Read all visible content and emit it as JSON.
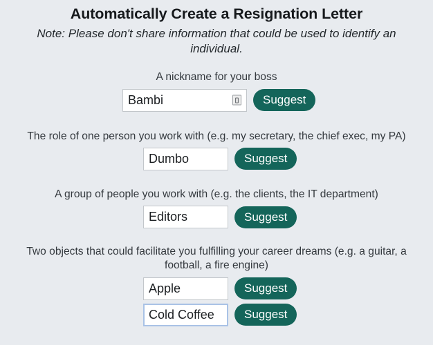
{
  "header": {
    "title": "Automatically Create a Resignation Letter",
    "note": "Note: Please don't share information that could be used to identify an individual."
  },
  "theme": {
    "background": "#e8ebef",
    "button_color": "#14655a",
    "button_text_color": "#ffffff",
    "input_background": "#ffffff",
    "input_border": "#c2c6ca",
    "focus_border": "#a9c2e6",
    "title_color": "#16191c",
    "label_color": "#34393e"
  },
  "fields": [
    {
      "label": "A nickname for your boss",
      "value": "Bambi",
      "placeholder": "",
      "button_label": "Suggest",
      "has_autofill_icon": true,
      "focused": false,
      "width": "wide"
    },
    {
      "label": "The role of one person you work with (e.g. my secretary, the chief exec, my PA)",
      "value": "Dumbo",
      "placeholder": "",
      "button_label": "Suggest",
      "has_autofill_icon": false,
      "focused": false,
      "width": "std"
    },
    {
      "label": "A group of people you work with (e.g. the clients, the IT department)",
      "value": "Editors",
      "placeholder": "",
      "button_label": "Suggest",
      "has_autofill_icon": false,
      "focused": false,
      "width": "std"
    },
    {
      "label": "Two objects that could facilitate you fulfilling your career dreams (e.g. a guitar, a football, a fire engine)",
      "value": "Apple",
      "placeholder": "",
      "button_label": "Suggest",
      "has_autofill_icon": false,
      "focused": false,
      "width": "std",
      "second_value": "Cold Coffee",
      "second_button_label": "Suggest",
      "second_focused": true
    }
  ],
  "icons": {
    "autofill": "form-autofill-icon"
  }
}
